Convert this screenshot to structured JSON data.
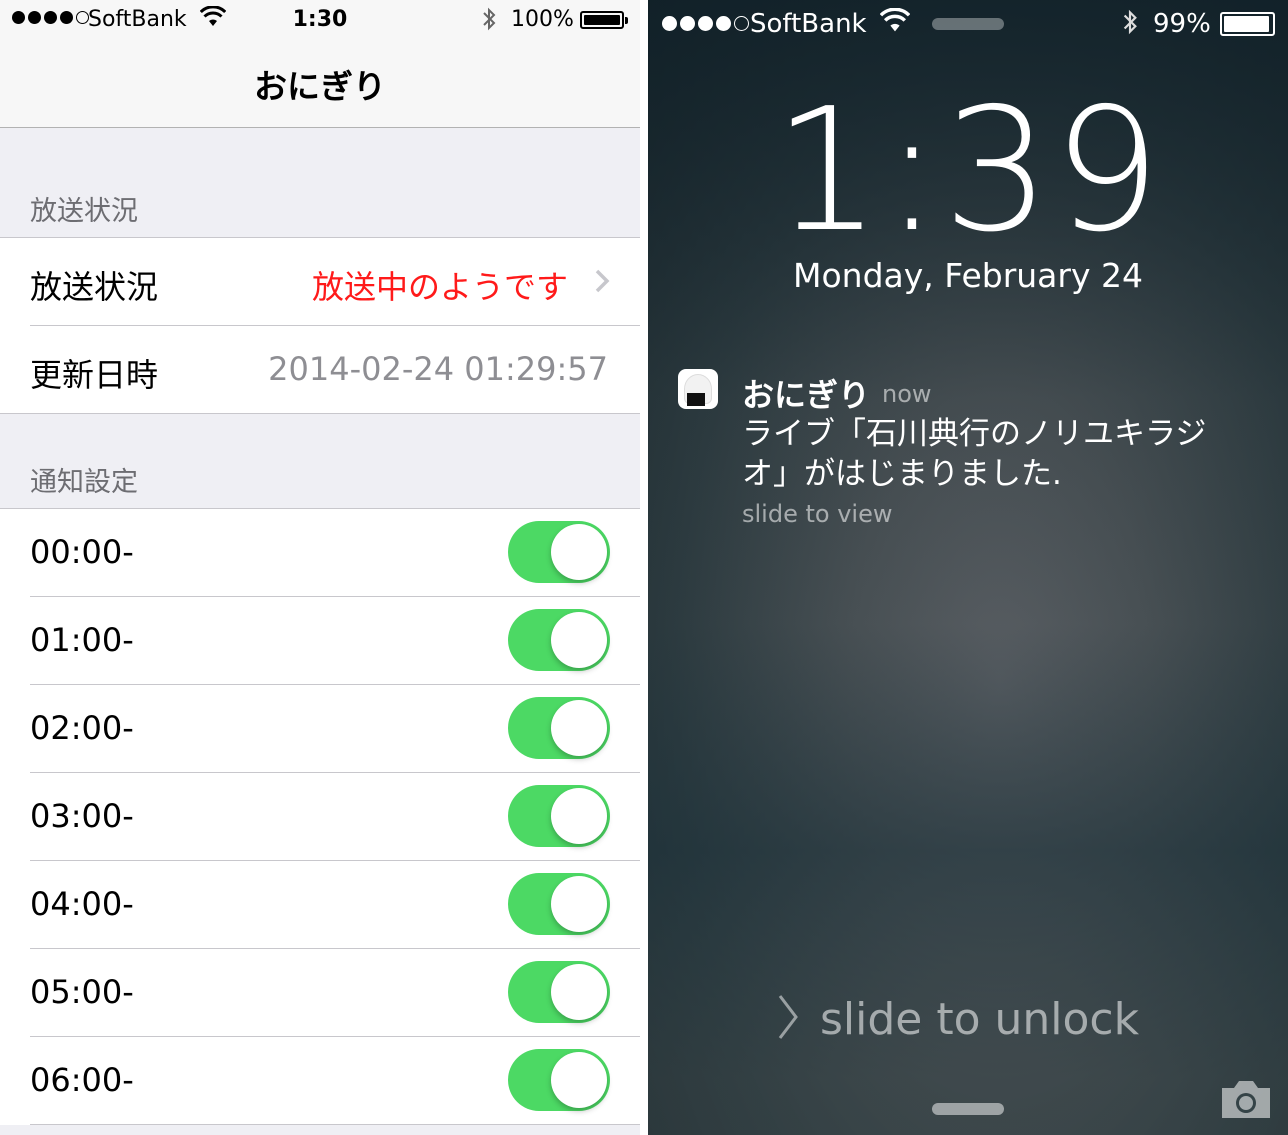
{
  "left": {
    "status_bar": {
      "carrier": "SoftBank",
      "time": "1:30",
      "battery": "100%"
    },
    "nav_title": "おにぎり",
    "section_broadcast": {
      "header": "放送状況",
      "status_label": "放送状況",
      "status_value": "放送中のようです",
      "updated_label": "更新日時",
      "updated_value": "2014-02-24 01:29:57"
    },
    "section_notify": {
      "header": "通知設定",
      "rows": [
        {
          "label": "00:00-",
          "on": true
        },
        {
          "label": "01:00-",
          "on": true
        },
        {
          "label": "02:00-",
          "on": true
        },
        {
          "label": "03:00-",
          "on": true
        },
        {
          "label": "04:00-",
          "on": true
        },
        {
          "label": "05:00-",
          "on": true
        },
        {
          "label": "06:00-",
          "on": true
        }
      ]
    },
    "colors": {
      "accent_red": "#ff1a1a",
      "switch_on": "#4cd964"
    }
  },
  "right": {
    "status_bar": {
      "carrier": "SoftBank",
      "battery": "99%"
    },
    "time": "1:39",
    "date": "Monday, February 24",
    "notification": {
      "app": "おにぎり",
      "time": "now",
      "body": "ライブ「石川典行のノリユキラジオ」がはじまりました.",
      "action": "slide to view"
    },
    "unlock_text": "slide to unlock",
    "icons": {
      "camera": "camera-icon",
      "wifi": "wifi-icon",
      "bluetooth": "bluetooth-icon"
    }
  }
}
